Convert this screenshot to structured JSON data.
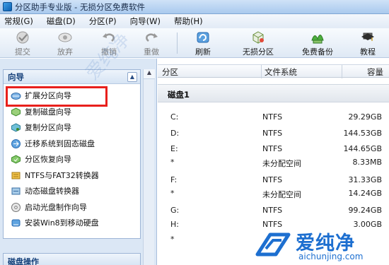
{
  "window": {
    "title": "分区助手专业版 - 无损分区免费软件"
  },
  "menu": [
    "常规(G)",
    "磁盘(D)",
    "分区(P)",
    "向导(W)",
    "帮助(H)"
  ],
  "toolbar": [
    {
      "label": "提交",
      "icon": "commit-check-icon",
      "disabled": true
    },
    {
      "label": "放弃",
      "icon": "discard-eye-icon",
      "disabled": true
    },
    {
      "label": "撤销",
      "icon": "undo-arrow-icon",
      "disabled": true
    },
    {
      "label": "重做",
      "icon": "redo-arrow-icon",
      "disabled": true
    },
    {
      "label": "刷新",
      "icon": "refresh-icon",
      "disabled": false
    },
    {
      "label": "无损分区",
      "icon": "lossless-partition-icon",
      "disabled": false
    },
    {
      "label": "免费备份",
      "icon": "free-backup-icon",
      "disabled": false
    },
    {
      "label": "教程",
      "icon": "tutorial-icon",
      "disabled": false
    }
  ],
  "wizard": {
    "header": "向导",
    "items": [
      "扩展分区向导",
      "复制磁盘向导",
      "复制分区向导",
      "迁移系统到固态磁盘",
      "分区恢复向导",
      "NTFS与FAT32转换器",
      "动态磁盘转换器",
      "启动光盘制作向导",
      "安装Win8到移动硬盘"
    ],
    "second_header": "磁盘操作"
  },
  "table": {
    "columns": [
      "分区",
      "文件系统",
      "容量"
    ],
    "disk_label": "磁盘1",
    "rows": [
      {
        "partition": "C:",
        "fs": "NTFS",
        "capacity": "29.29GB"
      },
      {
        "partition": "D:",
        "fs": "NTFS",
        "capacity": "144.53GB"
      },
      {
        "partition": "E:",
        "fs": "NTFS",
        "capacity": "144.65GB"
      },
      {
        "partition": "*",
        "fs": "未分配空间",
        "capacity": "8.33MB"
      },
      {
        "partition": "F:",
        "fs": "NTFS",
        "capacity": "31.33GB"
      },
      {
        "partition": "*",
        "fs": "未分配空间",
        "capacity": "14.24GB"
      },
      {
        "partition": "G:",
        "fs": "NTFS",
        "capacity": "99.24GB"
      },
      {
        "partition": "H:",
        "fs": "NTFS",
        "capacity": "3.00GB"
      },
      {
        "partition": "*",
        "fs": "",
        "capacity": ""
      }
    ]
  },
  "watermark": {
    "text": "爱纯净",
    "url": "aichunjing.com"
  },
  "colors": {
    "highlight": "#e8201c",
    "brand": "#1d6fd0"
  }
}
